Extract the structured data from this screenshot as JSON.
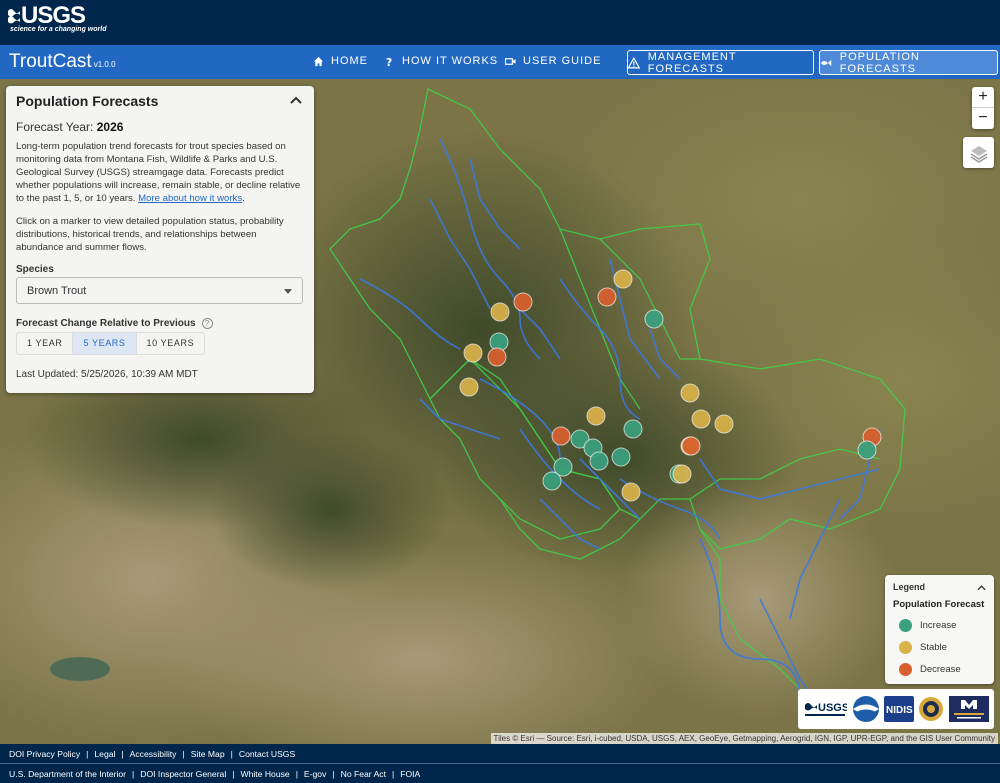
{
  "brand": {
    "logo_text": "USGS",
    "tagline": "science for a changing world"
  },
  "app": {
    "title": "TroutCast",
    "version": "v1.0.0"
  },
  "nav": {
    "home": "HOME",
    "how_it_works": "HOW IT WORKS",
    "user_guide": "USER GUIDE",
    "management_forecasts": "MANAGEMENT FORECASTS",
    "population_forecasts": "POPULATION FORECASTS"
  },
  "panel": {
    "title": "Population Forecasts",
    "forecast_year_label": "Forecast Year:",
    "forecast_year": "2026",
    "description": "Long-term population trend forecasts for trout species based on monitoring data from Montana Fish, Wildlife & Parks and U.S. Geological Survey (USGS) streamgage data. Forecasts predict whether populations will increase, remain stable, or decline relative to the past 1, 5, or 10 years.",
    "more_link": "More about how it works",
    "instructions": "Click on a marker to view detailed population status, probability distributions, historical trends, and relationships between abundance and summer flows.",
    "species_label": "Species",
    "species_value": "Brown Trout",
    "change_label": "Forecast Change Relative to Previous",
    "options": [
      "1 YEAR",
      "5 YEARS",
      "10 YEARS"
    ],
    "selected_option": "5 YEARS",
    "last_updated": "Last Updated: 5/25/2026, 10:39 AM MDT"
  },
  "map_controls": {
    "zoom_in": "+",
    "zoom_out": "−"
  },
  "legend": {
    "title": "Legend",
    "subtitle": "Population Forecast",
    "items": [
      {
        "label": "Increase",
        "color": "#3aa07f"
      },
      {
        "label": "Stable",
        "color": "#d9b24a"
      },
      {
        "label": "Decrease",
        "color": "#d8602e"
      }
    ]
  },
  "markers": [
    {
      "status": "Stable"
    },
    {
      "status": "Decrease"
    },
    {
      "status": "Decrease"
    },
    {
      "status": "Stable"
    },
    {
      "status": "Increase"
    },
    {
      "status": "Stable"
    },
    {
      "status": "Increase"
    },
    {
      "status": "Decrease"
    },
    {
      "status": "Stable"
    },
    {
      "status": "Stable"
    },
    {
      "status": "Stable"
    },
    {
      "status": "Stable"
    },
    {
      "status": "Stable"
    },
    {
      "status": "Stable"
    },
    {
      "status": "Decrease"
    },
    {
      "status": "Increase"
    },
    {
      "status": "Increase"
    },
    {
      "status": "Increase"
    },
    {
      "status": "Increase"
    },
    {
      "status": "Increase"
    },
    {
      "status": "Decrease"
    },
    {
      "status": "Increase"
    },
    {
      "status": "Increase"
    },
    {
      "status": "Increase"
    },
    {
      "status": "Stable"
    },
    {
      "status": "Stable"
    },
    {
      "status": "Decrease"
    },
    {
      "status": "Increase"
    }
  ],
  "partners": [
    "USGS",
    "NOAA",
    "NIDIS",
    "MSU Seal",
    "MONTANA STATE UNIVERSITY"
  ],
  "attribution": "Tiles © Esri — Source: Esri, i-cubed, USDA, USGS, AEX, GeoEye, Getmapping, Aerogrid, IGN, IGP, UPR-EGP, and the GIS User Community",
  "footer": {
    "row1": [
      "DOI Privacy Policy",
      "Legal",
      "Accessibility",
      "Site Map",
      "Contact USGS"
    ],
    "row2": [
      "U.S. Department of the Interior",
      "DOI Inspector General",
      "White House",
      "E-gov",
      "No Fear Act",
      "FOIA"
    ]
  }
}
